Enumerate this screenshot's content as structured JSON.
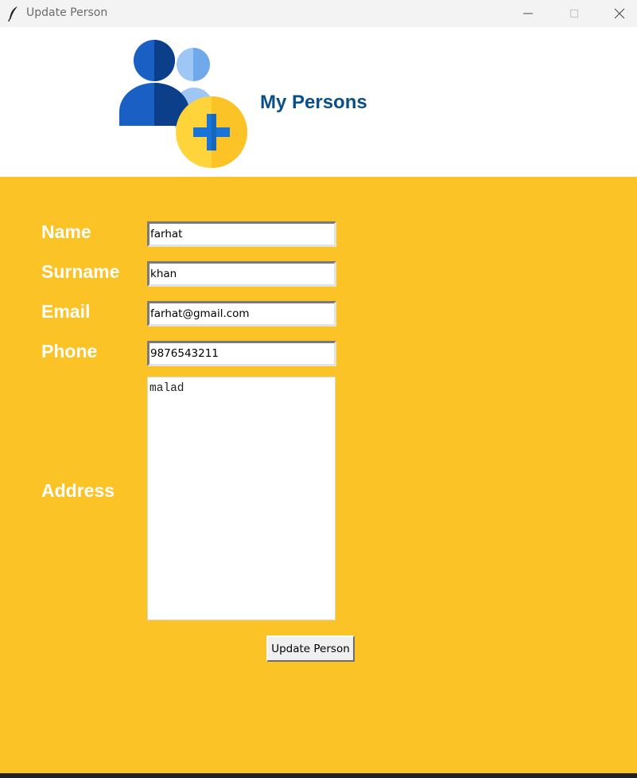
{
  "window": {
    "title": "Update Person",
    "controls": {
      "minimize_icon": "minimize-icon",
      "maximize_icon": "maximize-icon",
      "close_icon": "close-icon"
    }
  },
  "header": {
    "logo_icon": "persons-add-icon",
    "title": "My Persons"
  },
  "form": {
    "name": {
      "label": "Name",
      "value": "farhat"
    },
    "surname": {
      "label": "Surname",
      "value": "khan"
    },
    "email": {
      "label": "Email",
      "value": "farhat@gmail.com"
    },
    "phone": {
      "label": "Phone",
      "value": "9876543211"
    },
    "address": {
      "label": "Address",
      "value": "malad"
    },
    "submit_label": "Update Person"
  },
  "colors": {
    "form_background": "#fbc326",
    "heading": "#0b4f8a",
    "label": "#ffffff",
    "icon_dark_blue": "#0b4f8a",
    "icon_blue": "#1a73d6",
    "icon_light_blue": "#9ec7f5",
    "icon_yellow": "#fbc326"
  }
}
